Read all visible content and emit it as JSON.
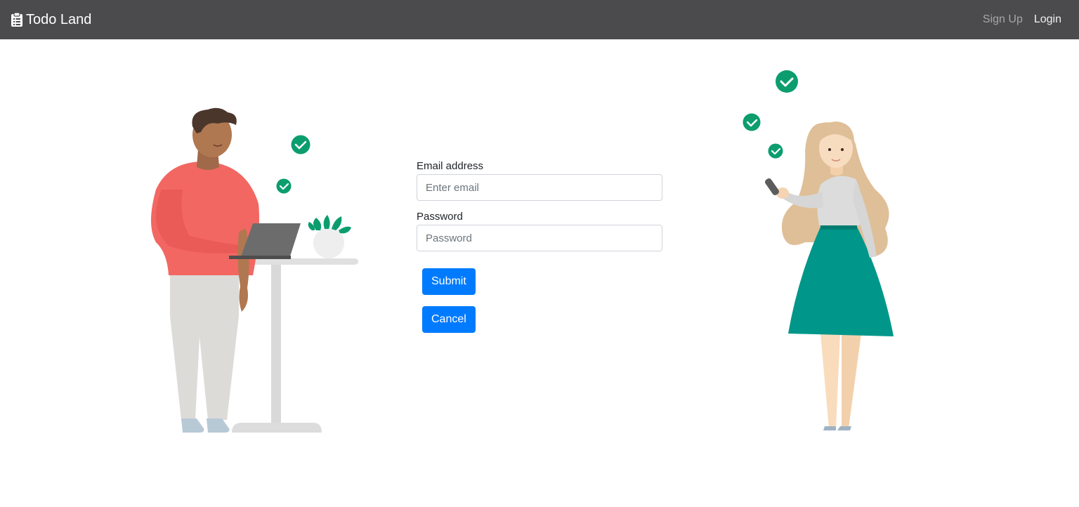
{
  "navbar": {
    "brand_label": "Todo Land",
    "brand_icon": "clipboard-icon",
    "links": [
      {
        "label": "Sign Up",
        "state": "muted"
      },
      {
        "label": "Login",
        "state": "active"
      }
    ]
  },
  "form": {
    "email": {
      "label": "Email address",
      "placeholder": "Enter email",
      "value": ""
    },
    "password": {
      "label": "Password",
      "placeholder": "Password",
      "value": ""
    },
    "submit_label": "Submit",
    "cancel_label": "Cancel"
  },
  "illustrations": {
    "left": "man-at-standing-desk-illustration",
    "right": "woman-with-phone-illustration"
  },
  "colors": {
    "navbar": "#4b4b4d",
    "primary": "#007bff",
    "check": "#0b9d6e",
    "teal": "#00968a",
    "shirt": "#f26762"
  }
}
